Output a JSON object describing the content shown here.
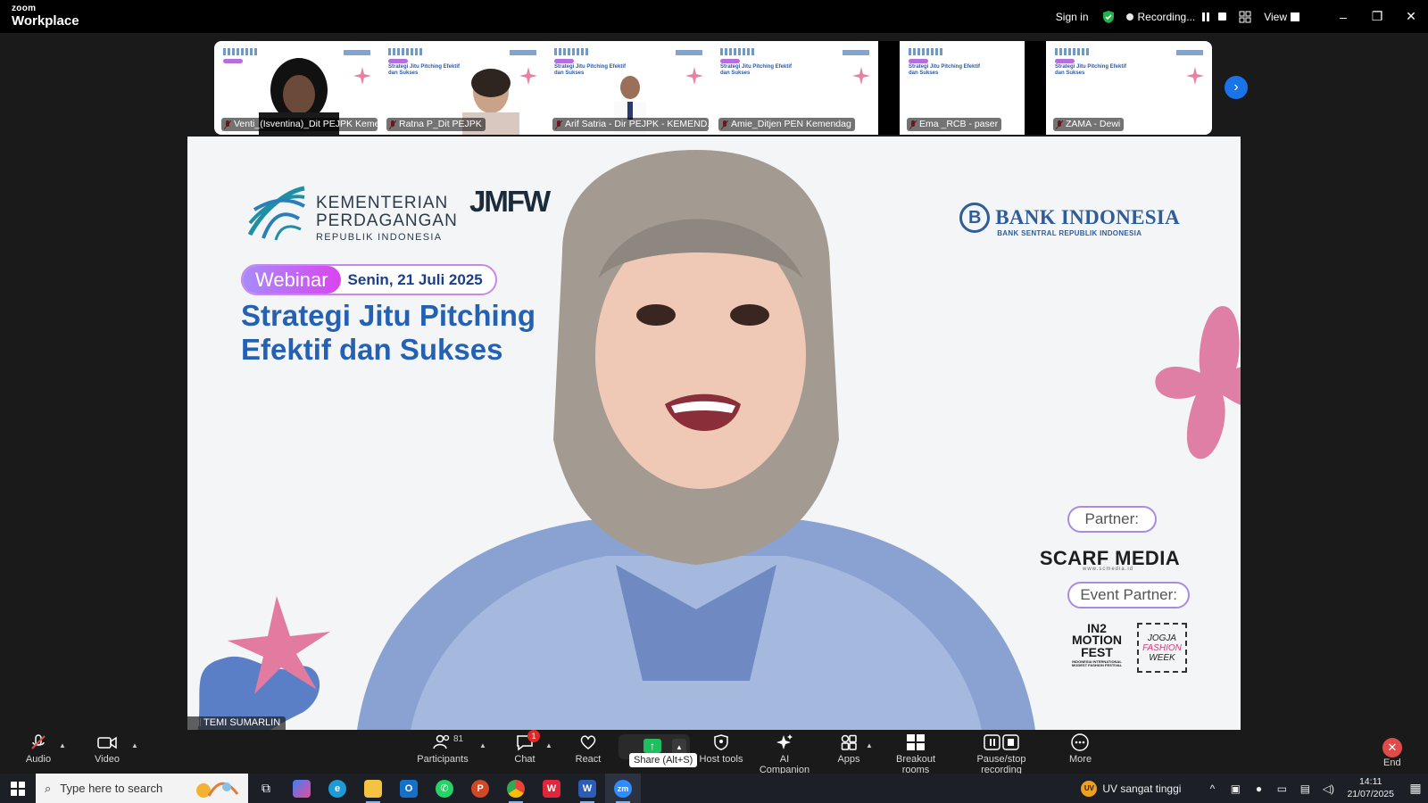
{
  "app": {
    "brand_top": "zoom",
    "brand_bottom": "Workplace",
    "sign_in": "Sign in",
    "recording_label": "Recording...",
    "view_label": "View",
    "window_controls": [
      "–",
      "❐",
      "✕"
    ]
  },
  "gallery": [
    {
      "name": "Venti_(Isventina)_Dit PEJPK Keme..."
    },
    {
      "name": "Ratna P_Dit PEJPK"
    },
    {
      "name": "Arif Satria - Dir PEJPK - KEMEND..."
    },
    {
      "name": "Amie_Ditjen PEN Kemendag"
    },
    {
      "name": "Ema _RCB - paser"
    },
    {
      "name": "ZAMA - Dewi"
    }
  ],
  "slide": {
    "ministry_line1": "KEMENTERIAN",
    "ministry_line2": "PERDAGANGAN",
    "ministry_line3": "REPUBLIK INDONESIA",
    "jmfw": "JMFW",
    "bank_name": "BANK INDONESIA",
    "bank_sub": "BANK SENTRAL REPUBLIK INDONESIA",
    "bank_letter": "B",
    "webinar_label": "Webinar",
    "date": "Senin, 21 Juli 2025",
    "headline": "Strategi Jitu Pitching Efektif dan Sukses",
    "partner_label": "Partner:",
    "partner_name": "SCARF MEDIA",
    "partner_url": "www.scmedia.id",
    "event_partner_label": "Event Partner:",
    "in2_line1": "IN2",
    "in2_line2": "MOTION",
    "in2_line3": "FEST",
    "in2_sub": "INDONESIA INTERNATIONAL MODEST FASHION FESTIVAL",
    "jogja_line1": "JOGJA",
    "jogja_line2": "FASHION",
    "jogja_line3": "WEEK"
  },
  "speaker": {
    "name": "TEMI SUMARLIN"
  },
  "toolbar": {
    "audio": "Audio",
    "video": "Video",
    "participants": "Participants",
    "participants_count": "81",
    "chat": "Chat",
    "chat_badge": "1",
    "react": "React",
    "share_tooltip": "Share (Alt+S)",
    "host_tools": "Host tools",
    "ai_companion": "AI Companion",
    "apps": "Apps",
    "breakout_rooms": "Breakout rooms",
    "pause_stop_recording": "Pause/stop recording",
    "more": "More",
    "end": "End"
  },
  "taskbar": {
    "search_placeholder": "Type here to search",
    "weather": "UV sangat tinggi",
    "uv_badge": "UV",
    "time": "14:11",
    "date": "21/07/2025"
  },
  "colors": {
    "accent_blue": "#1a73e8",
    "record_green": "#1fbf5f",
    "end_red": "#e24a4a",
    "headline_blue": "#2461b3"
  }
}
